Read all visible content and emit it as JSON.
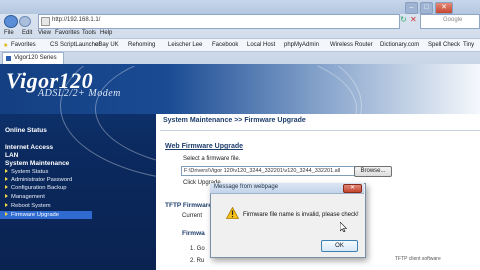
{
  "browser": {
    "address": "http://192.168.1.1/",
    "search_placeholder": "Google",
    "menu": [
      "File",
      "Edit",
      "View",
      "Favorites",
      "Tools",
      "Help"
    ],
    "favorites_label": "Favorites",
    "favorites": [
      "CS ScriptLauncher",
      "eBay UK",
      "Rehoming",
      "Leischer Lee",
      "Facebook",
      "Local Host",
      "phpMyAdmin",
      "Wireless Router",
      "Dictionary.com",
      "Spell Check",
      "Tiny"
    ],
    "tab_title": "Vigor120 Series"
  },
  "router": {
    "brand": "Vigor120",
    "model": "ADSL2/2+ Modem"
  },
  "nav": {
    "online_status": "Online Status",
    "internet_access": "Internet Access",
    "lan": "LAN",
    "system_maintenance": "System Maintenance",
    "items": [
      "System Status",
      "Administrator Password",
      "Configuration Backup",
      "Management",
      "Reboot System",
      "Firmware Upgrade"
    ]
  },
  "main": {
    "title": "System Maintenance >> Firmware Upgrade",
    "web_section": "Web Firmware Upgrade",
    "select_label": "Select a firmware file.",
    "file_path": "F:\\Drivers\\Vigor 120\\v120_3244_332201\\v120_3244_332201.all",
    "browse_label": "Browse...",
    "click_upgrade": "Click Upgrade",
    "tftp_section": "TFTP Firmware",
    "current_label": "Current",
    "firmware_label": "Firmwa",
    "step1": "1.  Go",
    "step2": "2.  Ru",
    "tftp_client": "TFTP client software"
  },
  "dialog": {
    "title": "Message from webpage",
    "message": "Firmware file name is invalid, please check!",
    "ok": "OK"
  },
  "colors": {
    "nav_bg": "#0b2a60",
    "nav_selected": "#2f6ad1",
    "heading": "#1d3d6b",
    "bullet": "#f2d34a"
  }
}
